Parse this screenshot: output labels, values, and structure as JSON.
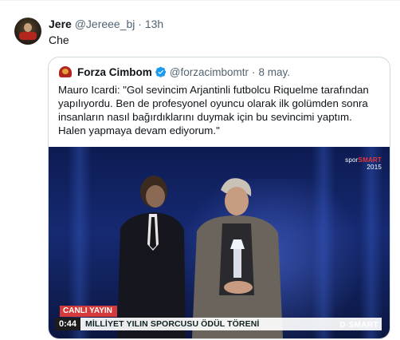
{
  "post": {
    "author_name": "Jere",
    "author_handle": "@Jereee_bj",
    "separator": "·",
    "time": "13h",
    "text": "Che"
  },
  "quote": {
    "author_name": "Forza Cimbom",
    "author_handle": "@forzacimbomtr",
    "separator": "·",
    "date": "8 may.",
    "text": "Mauro Icardi: \"Gol sevincim Arjantinli futbolcu Riquelme tarafından yapılıyordu. Ben de profesyonel oyuncu olarak ilk golümden sonra insanların nasıl bağırdıklarını duymak için bu sevincimi yaptım. Halen yapmaya devam ediyorum.\""
  },
  "video": {
    "channel_logo_prefix": "spor",
    "channel_logo_main": "SMART",
    "channel_logo_sub": "2015",
    "live_label": "CANLI YAYIN",
    "duration": "0:44",
    "lower_third": "MİLLİYET YILIN SPORCUSU ÖDÜL TÖRENİ",
    "brand": "D·SMART"
  },
  "colors": {
    "verified": "#1d9bf0",
    "text_primary": "#0f1419",
    "text_muted": "#536471",
    "live_red": "#d63b3b"
  },
  "icons": [
    "avatar",
    "verified-badge-icon",
    "play-video"
  ]
}
